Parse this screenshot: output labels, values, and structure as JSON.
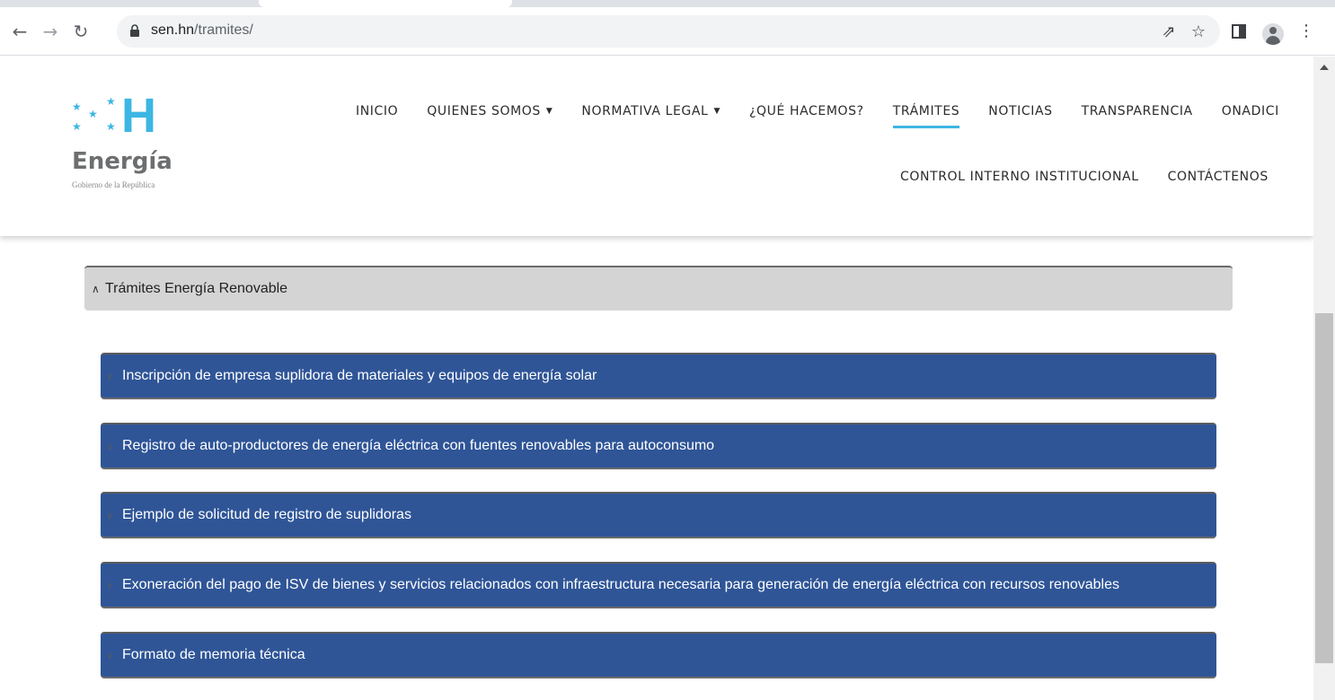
{
  "browser": {
    "url_host": "sen.hn",
    "url_path": "/tramites/",
    "icons": [
      "back-arrow-icon",
      "forward-arrow-icon",
      "reload-icon",
      "lock-icon",
      "share-icon",
      "star-icon",
      "side-panel-icon",
      "profile-avatar-icon",
      "kebab-menu-icon"
    ]
  },
  "logo": {
    "mark": "H",
    "brand": "Energía",
    "subtitle": "Gobierno de la República",
    "color": "#3cb6e3"
  },
  "nav": {
    "row1": [
      {
        "label": "INICIO",
        "dropdown": false
      },
      {
        "label": "QUIENES SOMOS",
        "dropdown": true
      },
      {
        "label": "NORMATIVA LEGAL",
        "dropdown": true
      },
      {
        "label": "¿QUÉ HACEMOS?",
        "dropdown": false
      },
      {
        "label": "TRÁMITES",
        "dropdown": false,
        "active": true
      },
      {
        "label": "NOTICIAS",
        "dropdown": false
      },
      {
        "label": "TRANSPARENCIA",
        "dropdown": false
      },
      {
        "label": "ONADICI",
        "dropdown": false
      }
    ],
    "row2": [
      {
        "label": "CONTROL INTERNO INSTITUCIONAL",
        "dropdown": false
      },
      {
        "label": "CONTÁCTENOS",
        "dropdown": false
      }
    ],
    "caret": "▼",
    "active_color": "#3cb6e3"
  },
  "accordion": {
    "title": "Trámites Energía Renovable",
    "chevron": "∧",
    "items": [
      "Inscripción de empresa suplidora de materiales y equipos de energía solar",
      "Registro de auto-productores de energía eléctrica con fuentes renovables para autoconsumo",
      "Ejemplo de solicitud de registro de suplidoras",
      "Exoneración del pago de ISV de bienes y servicios relacionados con infraestructura necesaria para generación de energía eléctrica con recursos renovables",
      "Formato de memoria técnica"
    ],
    "item_chevron": "∨",
    "item_color": "#2f5597"
  }
}
